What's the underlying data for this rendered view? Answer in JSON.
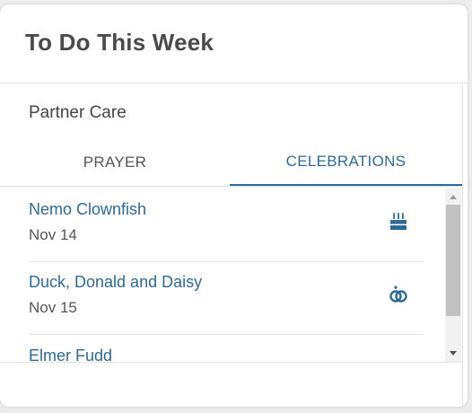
{
  "card": {
    "title": "To Do This Week"
  },
  "section": {
    "title": "Partner Care"
  },
  "tabs": [
    {
      "label": "PRAYER",
      "active": false
    },
    {
      "label": "CELEBRATIONS",
      "active": true
    }
  ],
  "items": [
    {
      "name": "Nemo Clownfish",
      "date": "Nov 14",
      "icon": "birthday-cake-icon"
    },
    {
      "name": "Duck, Donald and Daisy",
      "date": "Nov 15",
      "icon": "wedding-rings-icon"
    },
    {
      "name": "Elmer Fudd",
      "date": "",
      "icon": "more-icon"
    }
  ],
  "colors": {
    "accent": "#2e6a96",
    "title": "#4a4a4a",
    "text": "#555555"
  }
}
